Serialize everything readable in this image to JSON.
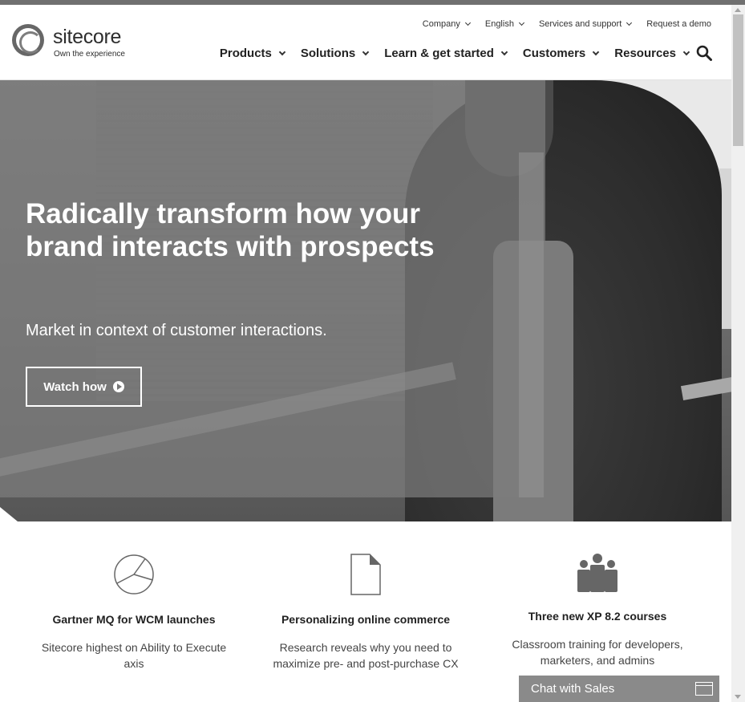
{
  "logo": {
    "name": "sitecore",
    "tagline": "Own the experience"
  },
  "utility_nav": [
    {
      "label": "Company"
    },
    {
      "label": "English"
    },
    {
      "label": "Services and support"
    },
    {
      "label": "Request a demo"
    }
  ],
  "main_nav": [
    {
      "label": "Products"
    },
    {
      "label": "Solutions"
    },
    {
      "label": "Learn & get started"
    },
    {
      "label": "Customers"
    },
    {
      "label": "Resources"
    }
  ],
  "hero": {
    "title": "Radically transform how your brand interacts with prospects",
    "subtitle": "Market in context of customer interactions.",
    "cta_label": "Watch how"
  },
  "features": [
    {
      "icon": "pie-chart-icon",
      "title": "Gartner MQ for WCM launches",
      "desc": "Sitecore highest on Ability to Execute axis"
    },
    {
      "icon": "document-icon",
      "title": "Personalizing online commerce",
      "desc": "Research reveals why you need to maximize pre- and post-purchase CX"
    },
    {
      "icon": "people-icon",
      "title": "Three new XP 8.2 courses",
      "desc": "Classroom training for developers, marketers, and admins"
    }
  ],
  "chat": {
    "label": "Chat with Sales"
  }
}
